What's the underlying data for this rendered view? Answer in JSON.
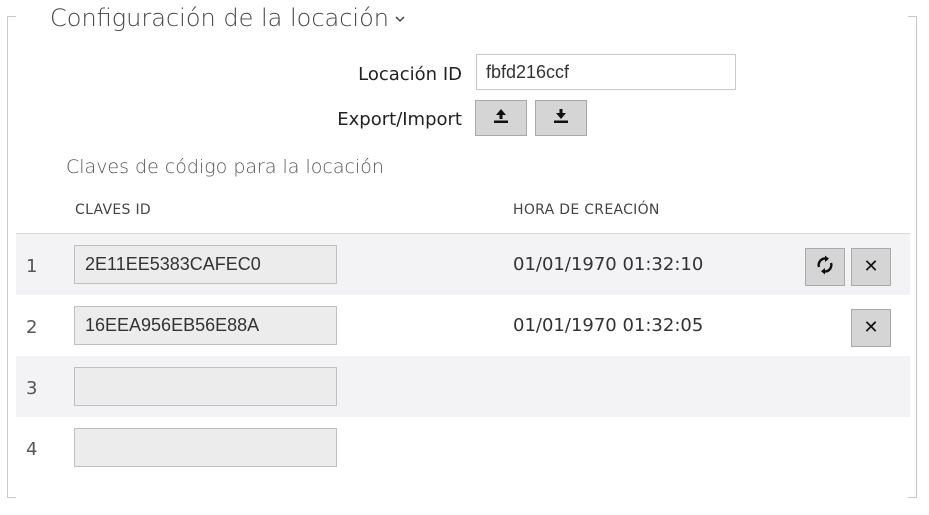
{
  "panel": {
    "title": "Configuración de la locación",
    "chevron_icon": "chevron-down-icon"
  },
  "form": {
    "location_id_label": "Locación ID",
    "location_id_value": "fbfd216ccf",
    "export_import_label": "Export/Import",
    "upload_icon": "upload-icon",
    "download_icon": "download-icon"
  },
  "keys_section": {
    "title": "Claves de código para la locación",
    "columns": {
      "id": "CLAVES ID",
      "created": "HORA DE CREACIÓN"
    },
    "rows": [
      {
        "num": "1",
        "key": "2E11EE5383CAFEC0",
        "created": "01/01/1970 01:32:10",
        "actions": [
          "refresh",
          "delete"
        ]
      },
      {
        "num": "2",
        "key": "16EEA956EB56E88A",
        "created": "01/01/1970 01:32:05",
        "actions": [
          "delete"
        ]
      },
      {
        "num": "3",
        "key": "",
        "created": "",
        "actions": []
      },
      {
        "num": "4",
        "key": "",
        "created": "",
        "actions": []
      }
    ],
    "delete_glyph": "✕"
  },
  "colors": {
    "button_bg": "#d5d5d5",
    "row_shade": "#f3f3f5",
    "input_bg": "#ececec"
  }
}
